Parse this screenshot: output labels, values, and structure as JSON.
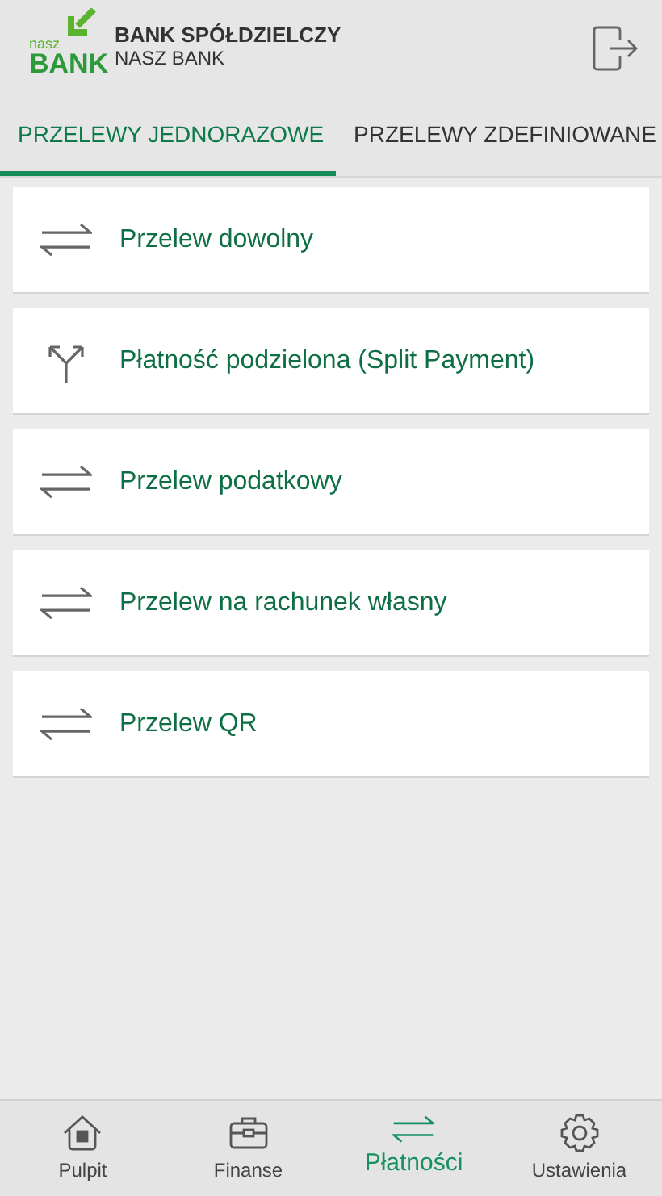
{
  "header": {
    "logo_small": "nasz",
    "logo_big": "BANK",
    "title": "BANK SPÓŁDZIELCZY",
    "subtitle": "NASZ BANK"
  },
  "tabs": [
    {
      "label": "PRZELEWY JEDNORAZOWE",
      "selected": true
    },
    {
      "label": "PRZELEWY ZDEFINIOWANE",
      "selected": false
    }
  ],
  "items": [
    {
      "kind": "transfer",
      "label": "Przelew dowolny"
    },
    {
      "kind": "split",
      "label": "Płatność podzielona (Split Payment)"
    },
    {
      "kind": "transfer",
      "label": "Przelew podatkowy"
    },
    {
      "kind": "transfer",
      "label": "Przelew na rachunek własny"
    },
    {
      "kind": "transfer",
      "label": "Przelew QR"
    }
  ],
  "nav": [
    {
      "kind": "home",
      "label": "Pulpit",
      "selected": false
    },
    {
      "kind": "briefcase",
      "label": "Finanse",
      "selected": false
    },
    {
      "kind": "transfer",
      "label": "Płatności",
      "selected": true
    },
    {
      "kind": "gear",
      "label": "Ustawienia",
      "selected": false
    }
  ]
}
